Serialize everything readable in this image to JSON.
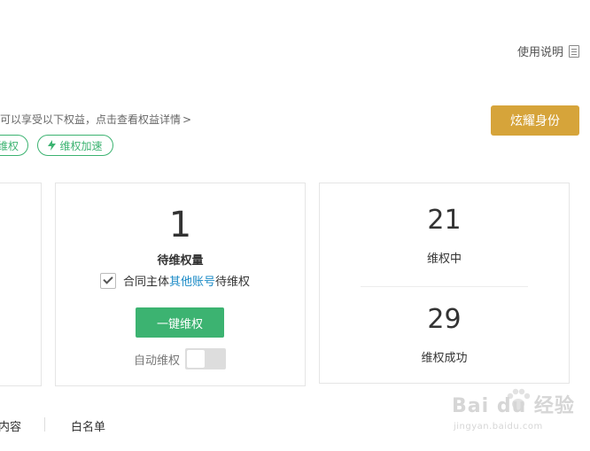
{
  "header": {
    "help_label": "使用说明",
    "help_icon": "doc-icon"
  },
  "benefits": {
    "text": "可以享受以下权益，点击查看权益详情",
    "chevron": ">",
    "cta_label": "炫耀身份",
    "pill_left_label": "维权",
    "pill_speed_label": "维权加速",
    "pill_speed_icon": "lightning-icon"
  },
  "pending": {
    "count": "1",
    "label": "待维权量",
    "checkbox_prefix": "合同主体",
    "checkbox_link": "其他账号",
    "checkbox_suffix": "待维权",
    "one_key_label": "一键维权",
    "auto_label": "自动维权",
    "auto_enabled": false
  },
  "progress": {
    "in_progress_count": "21",
    "in_progress_label": "维权中",
    "success_count": "29",
    "success_label": "维权成功"
  },
  "tabs": {
    "content": "内容",
    "whitelist": "白名单"
  },
  "watermark": {
    "text": "Bai du 经验",
    "url": "jingyan.baidu.com"
  },
  "colors": {
    "accent_green": "#3cb371",
    "cta_gold": "#d6a43a",
    "link_blue": "#1a8ac6"
  }
}
